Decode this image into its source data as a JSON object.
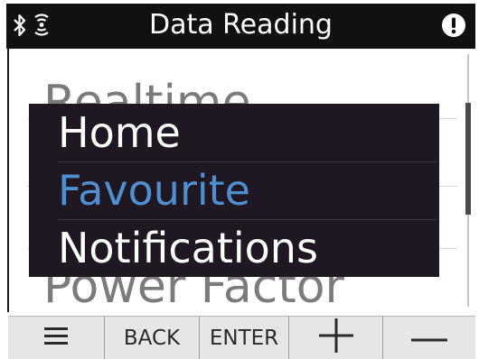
{
  "titlebar": {
    "title": "Data Reading",
    "icons": [
      "bluetooth-icon",
      "wireless-signal-icon",
      "alert-icon"
    ]
  },
  "background_list": {
    "items": [
      "Realtime",
      "Power Factor"
    ]
  },
  "popup_menu": {
    "items": [
      {
        "label": "Home",
        "color": "#ffffff"
      },
      {
        "label": "Favourite",
        "color": "#4f8fd0"
      },
      {
        "label": "Notifications",
        "color": "#ffffff"
      }
    ]
  },
  "bottombar": {
    "menu_icon": "menu-icon",
    "back_label": "BACK",
    "enter_label": "ENTER",
    "plus_icon": "plus-icon",
    "minus_icon": "minus-icon"
  },
  "colors": {
    "titlebar_bg": "#111111",
    "popup_bg": "#1f1721",
    "selected": "#4f8fd0",
    "bottombar_bg": "#e6e6e6"
  }
}
